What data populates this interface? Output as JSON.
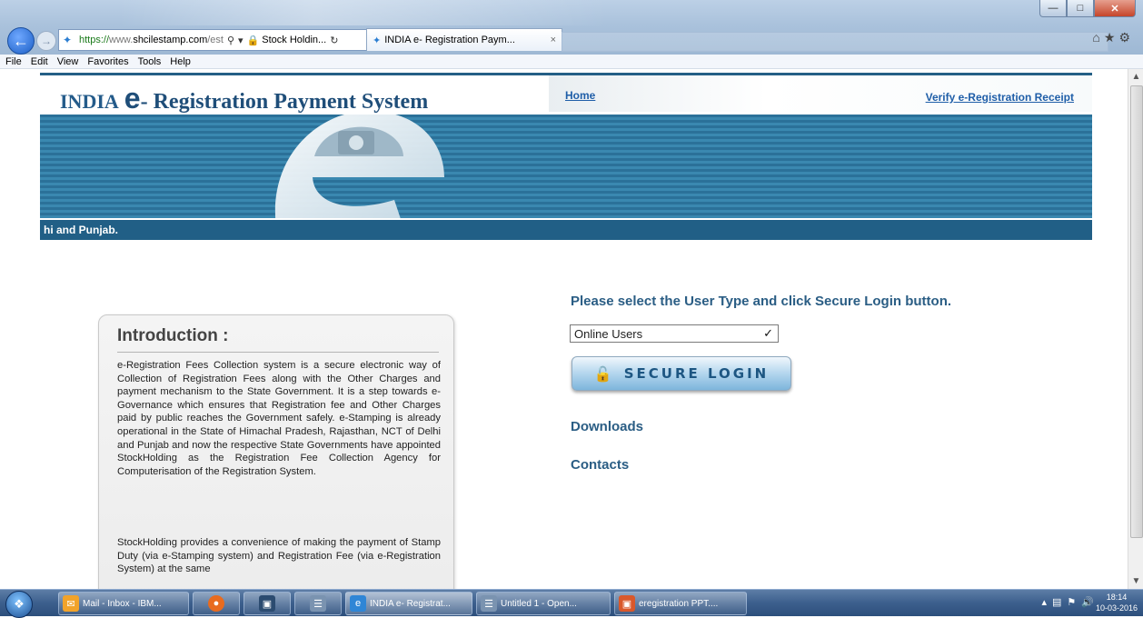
{
  "browser": {
    "url_prefix": "https://",
    "url_mid": "www.",
    "url_host": "shcilestamp.com",
    "url_tail": "/est",
    "tab2_label": "Stock Holdin...",
    "active_tab_label": "INDIA e- Registration Paym...",
    "menu": [
      "File",
      "Edit",
      "View",
      "Favorites",
      "Tools",
      "Help"
    ]
  },
  "header": {
    "logo_india": "INDIA",
    "logo_e": "e",
    "logo_rest": "- Registration Payment System",
    "nav_home": "Home",
    "nav_verify": "Verify e-Registration Receipt"
  },
  "ticker": {
    "text": "hi and Punjab."
  },
  "intro": {
    "title": "Introduction :",
    "para1": "e-Registration Fees Collection system is a secure electronic way of Collection of Registration Fees along with the Other Charges and payment mechanism to the State Government. It is a step towards e-Governance which ensures that Registration fee and Other Charges paid by public reaches the Government safely. e-Stamping is already operational in the State of Himachal Pradesh, Rajasthan, NCT of Delhi and Punjab and now the respective State Governments have appointed StockHolding as the Registration Fee Collection Agency for Computerisation of the Registration System.",
    "para2": "StockHolding provides a convenience of making the payment of Stamp Duty (via e-Stamping system) and Registration Fee (via e-Registration System) at the same"
  },
  "login": {
    "prompt": "Please select the User Type and click Secure Login button.",
    "user_type": "Online Users",
    "secure_login": "SECURE LOGIN",
    "downloads": "Downloads",
    "contacts": "Contacts"
  },
  "taskbar": {
    "items": [
      "Mail - Inbox - IBM...",
      "",
      "",
      "",
      "INDIA e- Registrat...",
      "Untitled 1 - Open...",
      "eregistration PPT...."
    ],
    "time": "18:14",
    "date": "10-03-2016"
  }
}
